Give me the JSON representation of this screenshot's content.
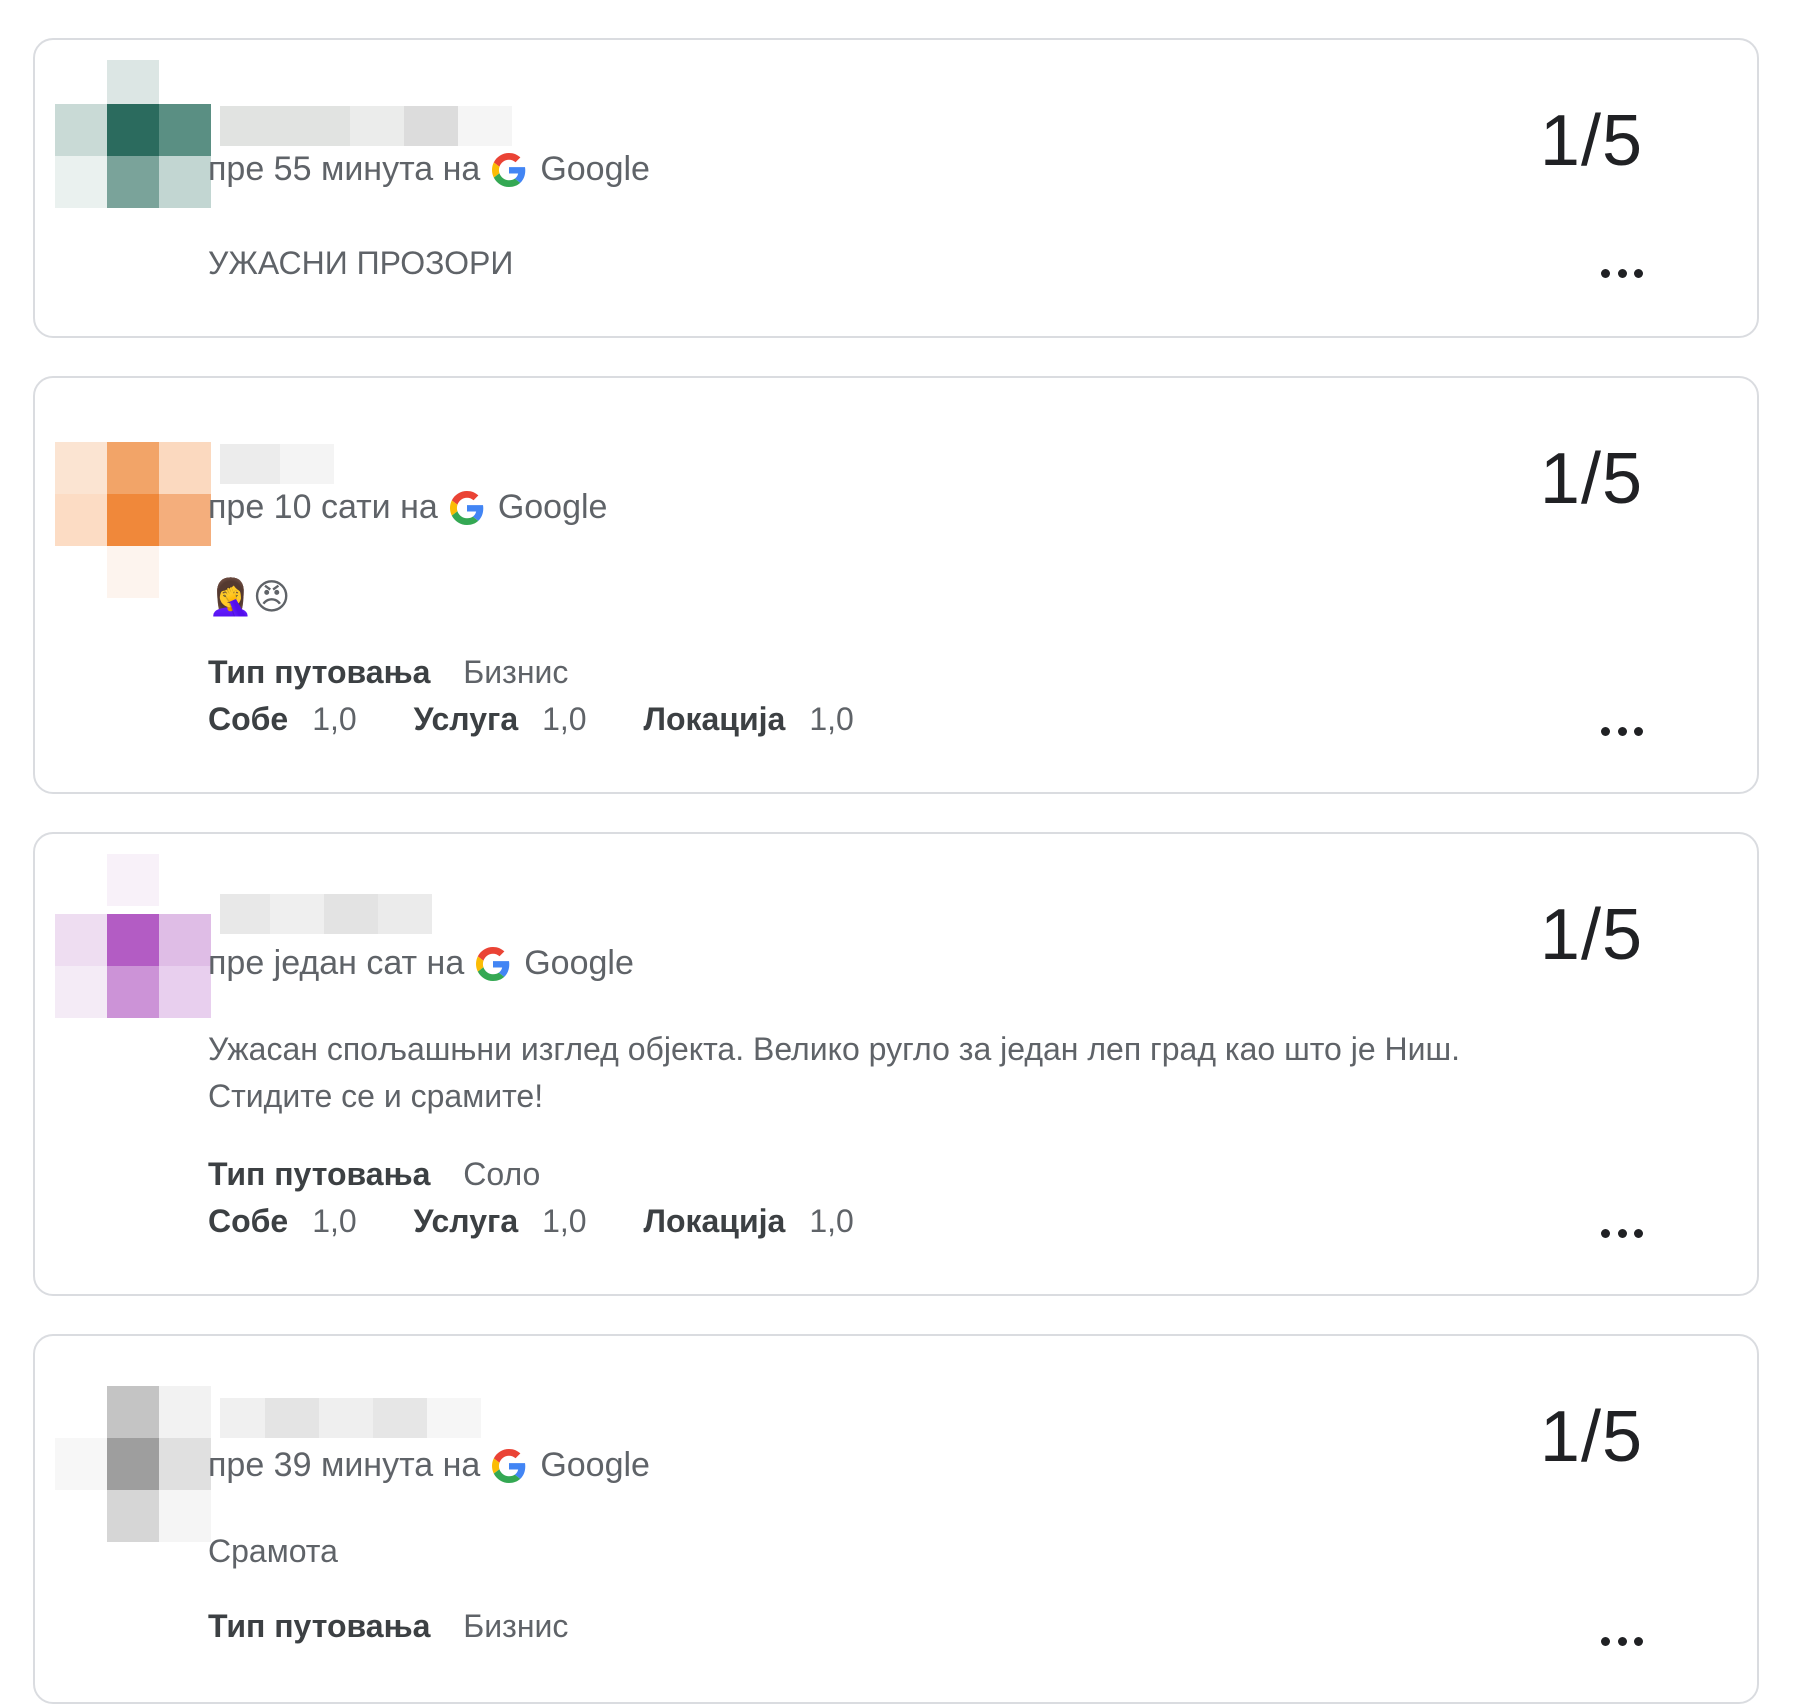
{
  "reviews": [
    {
      "time": "пре 55 минута на",
      "source": "Google",
      "score": "1/5",
      "text": "УЖАСНИ ПРОЗОРИ",
      "avatar_color": "#2b6b5e"
    },
    {
      "time": "пре 10 сати на",
      "source": "Google",
      "score": "1/5",
      "text": "🤦‍♀️😠",
      "trip_label": "Тип путовања",
      "trip_value": "Бизнис",
      "ratings": [
        {
          "label": "Собе",
          "value": "1,0"
        },
        {
          "label": "Услуга",
          "value": "1,0"
        },
        {
          "label": "Локација",
          "value": "1,0"
        }
      ],
      "avatar_color": "#f0883a"
    },
    {
      "time": "пре један сат на",
      "source": "Google",
      "score": "1/5",
      "text": "Ужасан спољашњни изглед објекта. Велико ругло за један леп град као што је Ниш. Стидите се и срамите!",
      "trip_label": "Тип путовања",
      "trip_value": "Соло",
      "ratings": [
        {
          "label": "Собе",
          "value": "1,0"
        },
        {
          "label": "Услуга",
          "value": "1,0"
        },
        {
          "label": "Локација",
          "value": "1,0"
        }
      ],
      "avatar_color": "#b35cc4"
    },
    {
      "time": "пре 39 минута на",
      "source": "Google",
      "score": "1/5",
      "text": "Срамота",
      "trip_label": "Тип путовања",
      "trip_value": "Бизнис",
      "avatar_color": "#9e9e9e"
    }
  ],
  "icons": {
    "menu": "more-horizontal-icon",
    "source": "google-g-icon"
  }
}
